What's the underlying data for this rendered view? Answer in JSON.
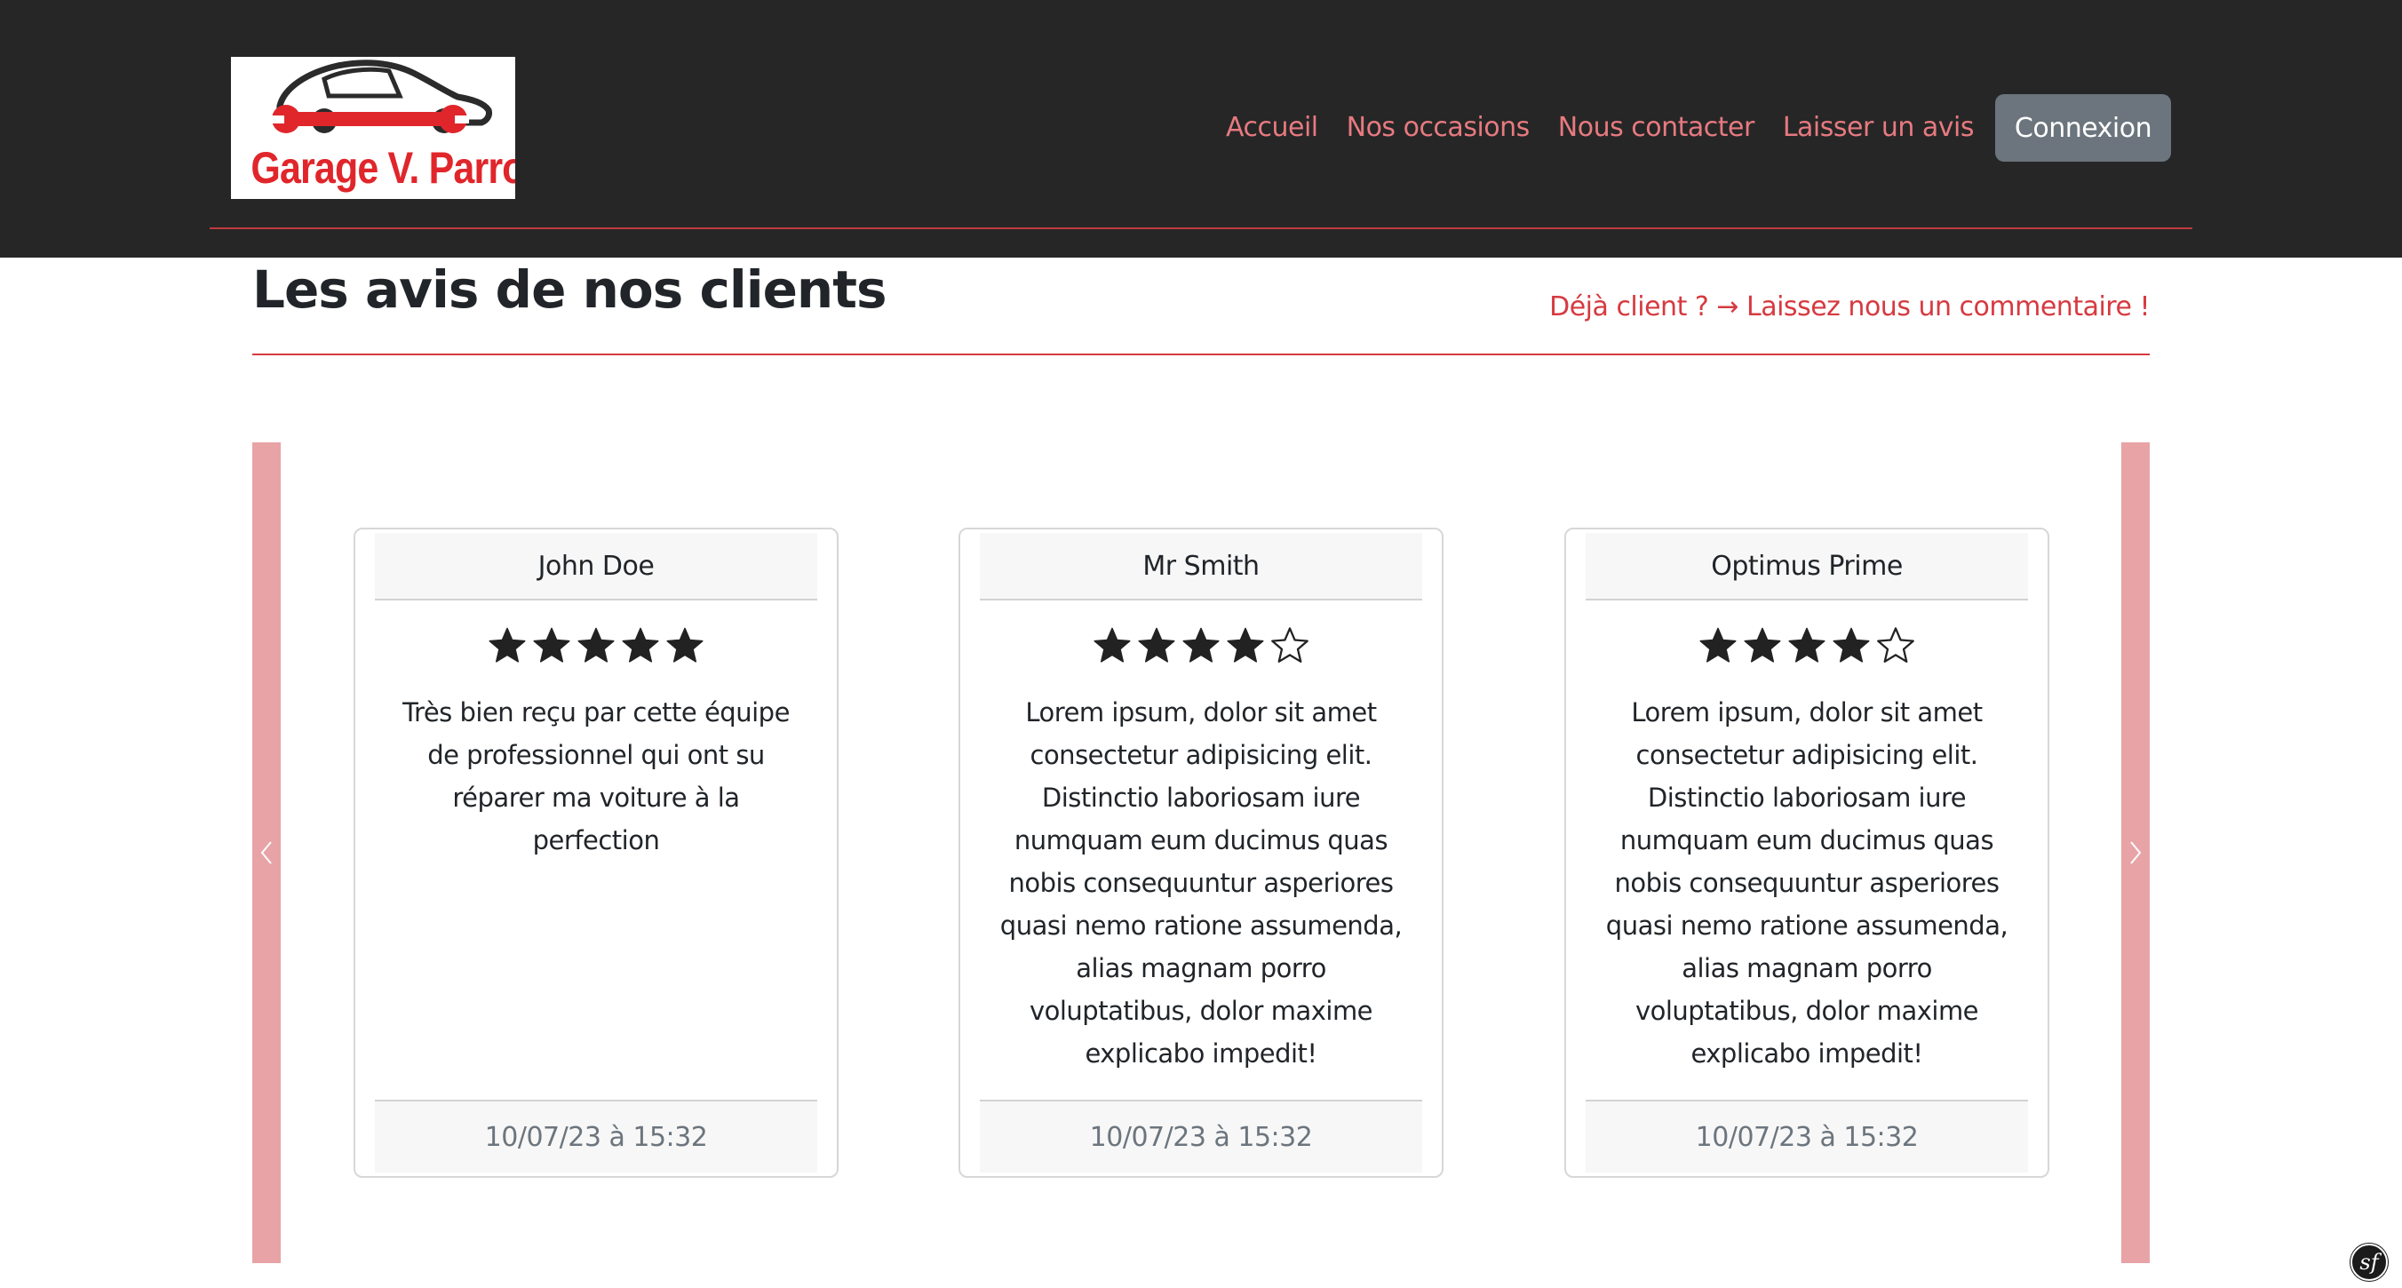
{
  "header": {
    "logo_text": "Garage V. Parrot",
    "logo_icon": "car-wrench-icon",
    "nav": [
      {
        "label": "Accueil"
      },
      {
        "label": "Nos occasions"
      },
      {
        "label": "Nous contacter"
      },
      {
        "label": "Laisser un avis"
      }
    ],
    "login_label": "Connexion"
  },
  "main": {
    "title": "Les avis de nos clients",
    "cta_link": "Déjà client ? → Laissez nous un commentaire !"
  },
  "carousel": {
    "prev_icon": "chevron-left-icon",
    "next_icon": "chevron-right-icon",
    "reviews": [
      {
        "author": "John Doe",
        "rating": 5,
        "max_rating": 5,
        "text": "Très bien reçu par cette équipe de professionnel qui ont su réparer ma voiture à la perfection",
        "date": "10/07/23 à 15:32"
      },
      {
        "author": "Mr Smith",
        "rating": 4,
        "max_rating": 5,
        "text": "Lorem ipsum, dolor sit amet consectetur adipisicing elit. Distinctio laboriosam iure numquam eum ducimus quas nobis consequuntur asperiores quasi nemo ratione assumenda, alias magnam porro voluptatibus, dolor maxime explicabo impedit!",
        "date": "10/07/23 à 15:32"
      },
      {
        "author": "Optimus Prime",
        "rating": 4,
        "max_rating": 5,
        "text": "Lorem ipsum, dolor sit amet consectetur adipisicing elit. Distinctio laboriosam iure numquam eum ducimus quas nobis consequuntur asperiores quasi nemo ratione assumenda, alias magnam porro voluptatibus, dolor maxime explicabo impedit!",
        "date": "10/07/23 à 15:32"
      }
    ]
  },
  "debug_toolbar": {
    "icon": "symfony-icon",
    "label": "sf"
  },
  "colors": {
    "header_bg": "#262626",
    "accent": "#d63a40",
    "nav_link": "#e77a80",
    "carousel_control": "#e8a3a6",
    "login_button": "#6c757d"
  }
}
